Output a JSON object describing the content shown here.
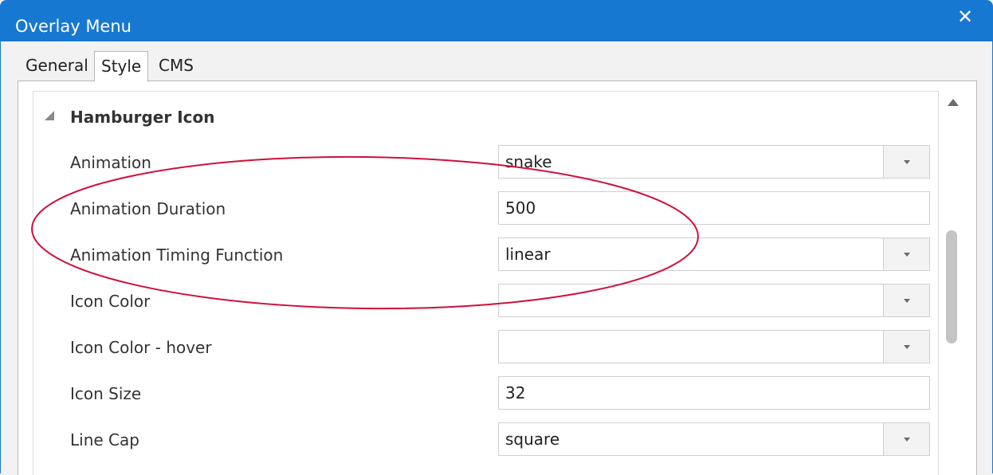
{
  "window": {
    "title": "Overlay Menu",
    "close_glyph": "✕"
  },
  "tabs": [
    {
      "label": "General",
      "selected": false
    },
    {
      "label": "Style",
      "selected": true
    },
    {
      "label": "CMS",
      "selected": false
    }
  ],
  "section": {
    "title": "Hamburger Icon",
    "expanded": true
  },
  "properties": [
    {
      "label": "Animation",
      "value": "snake",
      "type": "dropdown"
    },
    {
      "label": "Animation Duration",
      "value": "500",
      "type": "text"
    },
    {
      "label": "Animation Timing Function",
      "value": "linear",
      "type": "dropdown"
    },
    {
      "label": "Icon Color",
      "value": "",
      "type": "dropdown"
    },
    {
      "label": "Icon Color - hover",
      "value": "",
      "type": "dropdown"
    },
    {
      "label": "Icon Size",
      "value": "32",
      "type": "text"
    },
    {
      "label": "Line Cap",
      "value": "square",
      "type": "dropdown"
    }
  ],
  "colors": {
    "titlebar": "#1778d2",
    "annotation": "#d0103a"
  },
  "icons": {
    "close": "close-icon",
    "expander": "collapse-triangle-icon",
    "dropdown": "chevron-down-icon",
    "scroll_up": "scroll-up-arrow-icon"
  }
}
